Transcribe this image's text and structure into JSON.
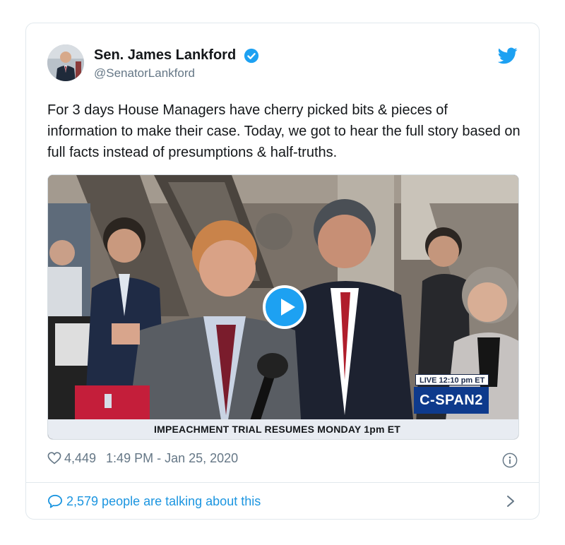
{
  "tweet": {
    "author_name": "Sen. James Lankford",
    "handle": "@SenatorLankford",
    "text": "For 3 days House Managers have cherry picked bits & pieces of information to make their case. Today, we got to hear the full story based on full facts instead of presumptions & half-truths.",
    "likes": "4,449",
    "timestamp": "1:49 PM - Jan 25, 2020",
    "talking": "2,579 people are talking about this"
  },
  "video": {
    "live_tag": "LIVE 12:10 pm ET",
    "network": "C-SPAN2",
    "ticker": "IMPEACHMENT TRIAL RESUMES MONDAY 1pm ET"
  },
  "icons": {
    "verified": "verified-badge-icon",
    "brand": "twitter-bird-icon",
    "play": "play-icon",
    "like": "heart-icon",
    "info": "info-icon",
    "reply": "comment-bubble-icon",
    "chevron": "chevron-right-icon"
  },
  "colors": {
    "twitter_blue": "#1da1f2",
    "link_blue": "#1b95e0",
    "muted": "#657786",
    "text": "#14171a",
    "cspan_blue": "#0e3a8c"
  }
}
